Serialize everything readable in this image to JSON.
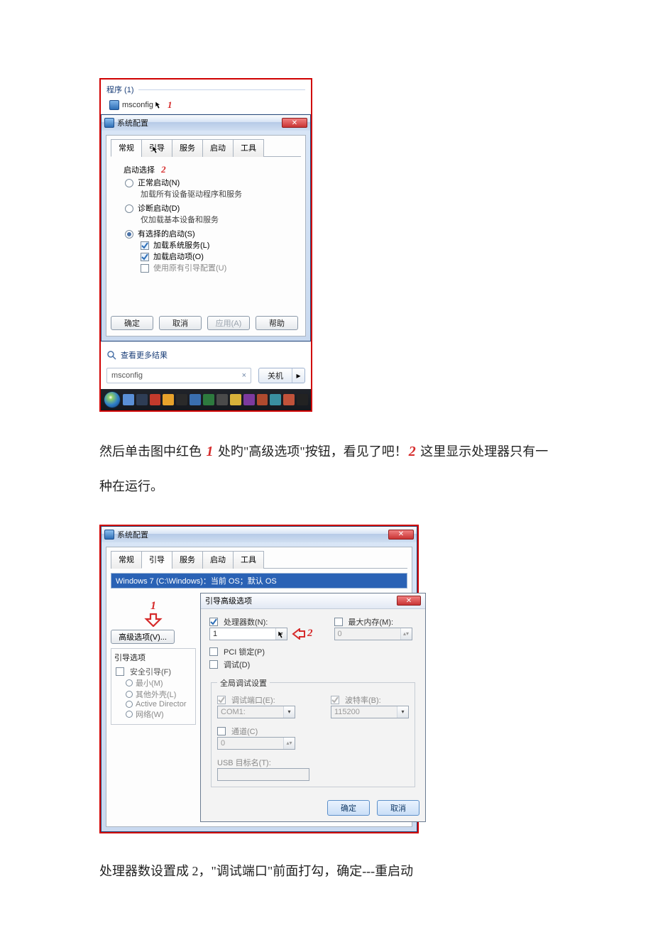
{
  "fig1": {
    "programs_header": "程序 (1)",
    "msconfig_item": "msconfig",
    "annot1": "1",
    "window_title": "系统配置",
    "tabs": [
      "常规",
      "引导",
      "服务",
      "启动",
      "工具"
    ],
    "annot2": "2",
    "group_label": "启动选择",
    "normal": "正常启动(N)",
    "normal_sub": "加载所有设备驱动程序和服务",
    "diag": "诊断启动(D)",
    "diag_sub": "仅加载基本设备和服务",
    "selective": "有选择的启动(S)",
    "load_services": "加载系统服务(L)",
    "load_startup": "加载启动项(O)",
    "use_original_boot": "使用原有引导配置(U)",
    "ok": "确定",
    "cancel": "取消",
    "apply": "应用(A)",
    "help": "帮助",
    "see_more": "查看更多结果",
    "search_value": "msconfig",
    "shutdown": "关机"
  },
  "para1": {
    "t1": "然后单击图中红色 ",
    "n1": "1",
    "t2": " 处旳\"高级选项\"按钮，看见了吧！",
    "n2": "2",
    "t3": " 这里显示处理器只有一种在运行。"
  },
  "fig2": {
    "window_title": "系统配置",
    "tabs": [
      "常规",
      "引导",
      "服务",
      "启动",
      "工具"
    ],
    "bootlist": "Windows 7 (C:\\Windows)：当前 OS；默认 OS",
    "annot1": "1",
    "adv_btn": "高级选项(V)...",
    "boot_options_title": "引导选项",
    "safe_boot": "安全引导(F)",
    "min": "最小(M)",
    "altshell": "其他外壳(L)",
    "ad": "Active Director",
    "network": "网络(W)",
    "inner_title": "引导高级选项",
    "proc_label": "处理器数(N):",
    "proc_value": "1",
    "annot2": "2",
    "maxmem_label": "最大内存(M):",
    "maxmem_value": "0",
    "pci_lock": "PCI 锁定(P)",
    "debug": "调试(D)",
    "global_title": "全局调试设置",
    "debug_port_label": "调试端口(E):",
    "debug_port_value": "COM1:",
    "baud_label": "波特率(B):",
    "baud_value": "115200",
    "channel_label": "通道(C)",
    "channel_value": "0",
    "usb_target": "USB 目标名(T):",
    "ok": "确定",
    "cancel": "取消"
  },
  "para2": "处理器数设置成 2，\"调试端口\"前面打勾，确定---重启动"
}
